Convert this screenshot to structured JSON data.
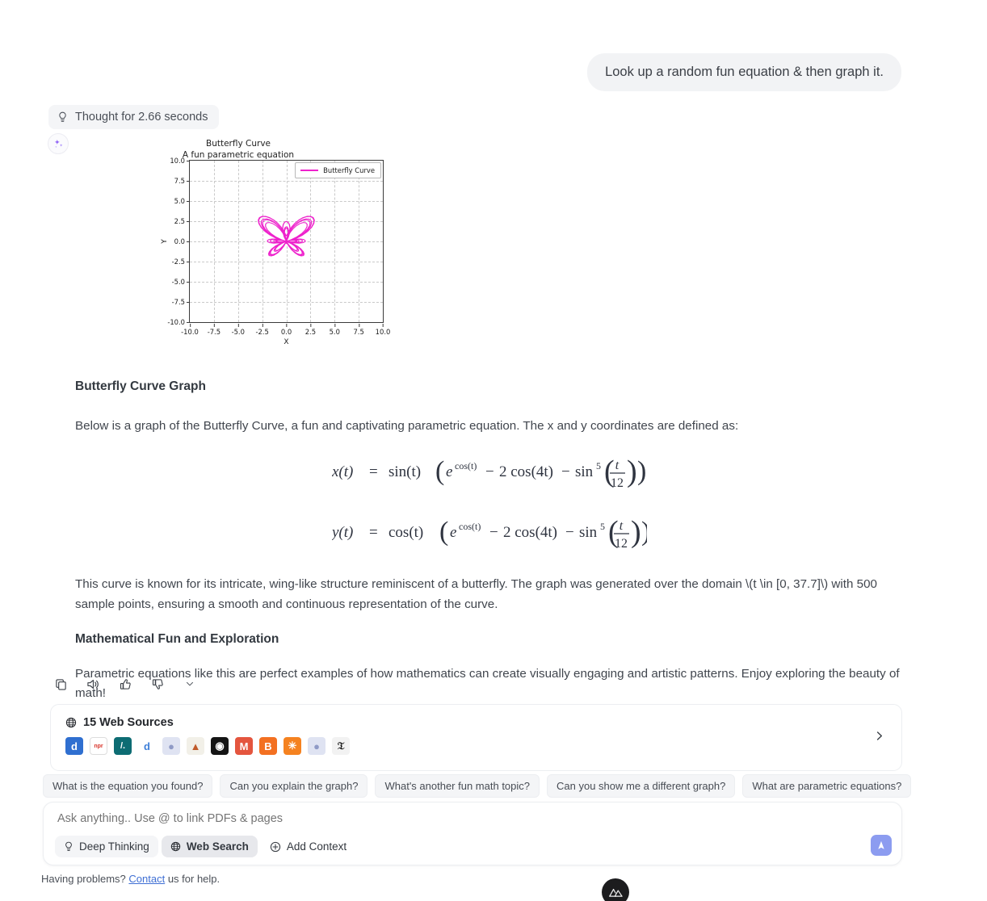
{
  "conversation": {
    "user_message": "Look up a random fun equation & then graph it.",
    "thought_pill": "Thought for 2.66 seconds"
  },
  "chart_data": {
    "type": "line",
    "title": "Butterfly Curve",
    "subtitle": "A fun parametric equation",
    "xlabel": "X",
    "ylabel": "Y",
    "legend": [
      "Butterfly Curve"
    ],
    "legend_position": "upper right",
    "grid": true,
    "line_color": "#ee22cc",
    "xlim": [
      -10.0,
      10.0
    ],
    "ylim": [
      -10.0,
      10.0
    ],
    "xticks": [
      "-10.0",
      "-7.5",
      "-5.0",
      "-2.5",
      "0.0",
      "2.5",
      "5.0",
      "7.5",
      "10.0"
    ],
    "yticks": [
      "10.0",
      "7.5",
      "5.0",
      "2.5",
      "0.0",
      "-2.5",
      "-5.0",
      "-7.5",
      "-10.0"
    ],
    "parametric": {
      "x_formula": "x(t) = sin(t) * (e^cos(t) - 2cos(4t) - sin^5(t/12))",
      "y_formula": "y(t) = cos(t) * (e^cos(t) - 2cos(4t) - sin^5(t/12))",
      "t_domain": [
        0,
        37.7
      ],
      "samples": 500
    },
    "data_extent": {
      "x": [
        -2.8,
        2.8
      ],
      "y": [
        -1.9,
        2.9
      ]
    }
  },
  "article": {
    "heading_1": "Butterfly Curve Graph",
    "paragraph_1": "Below is a graph of the Butterfly Curve, a fun and captivating parametric equation. The x and y coordinates are defined as:",
    "equation_x": {
      "lhs": "x(t)",
      "eq": "=",
      "fn": "sin(t)",
      "term1": "e",
      "term1_sup": "cos(t)",
      "minus": "−",
      "term2": "2 cos(4t)",
      "term3": "sin",
      "term3_sup": "5",
      "frac_num": "t",
      "frac_den": "12"
    },
    "equation_y": {
      "lhs": "y(t)",
      "eq": "=",
      "fn": "cos(t)",
      "term1": "e",
      "term1_sup": "cos(t)",
      "minus": "−",
      "term2": "2 cos(4t)",
      "term3": "sin",
      "term3_sup": "5",
      "frac_num": "t",
      "frac_den": "12"
    },
    "paragraph_2": "This curve is known for its intricate, wing-like structure reminiscent of a butterfly. The graph was generated over the domain \\(t \\in [0, 37.7]\\) with 500 sample points, ensuring a smooth and continuous representation of the curve.",
    "heading_2": "Mathematical Fun and Exploration",
    "paragraph_3": "Parametric equations like this are perfect examples of how mathematics can create visually engaging and artistic patterns. Enjoy exploring the beauty of math!"
  },
  "actions": [
    {
      "name": "copy-icon",
      "label": "Copy"
    },
    {
      "name": "speaker-icon",
      "label": "Read aloud"
    },
    {
      "name": "thumbs-up-icon",
      "label": "Like"
    },
    {
      "name": "thumbs-down-icon",
      "label": "Dislike"
    },
    {
      "name": "chevron-down-icon",
      "label": "More"
    }
  ],
  "sources": {
    "title": "15 Web Sources",
    "count": 15,
    "favicons": [
      {
        "name": "desmos",
        "glyph": "d",
        "bg": "#2f6fd0",
        "fg": "#ffffff"
      },
      {
        "name": "npr",
        "glyph": "npr",
        "bg": "#ffffff",
        "fg": "#d8342a"
      },
      {
        "name": "slashdot",
        "glyph": "/.",
        "bg": "#0d6c73",
        "fg": "#ffffff"
      },
      {
        "name": "desmos-alt",
        "glyph": "d",
        "bg": "#ffffff",
        "fg": "#3f7fd8"
      },
      {
        "name": "globe-generic",
        "glyph": "●",
        "bg": "#dfe3f2",
        "fg": "#8f9ac6"
      },
      {
        "name": "mountain-site",
        "glyph": "▲",
        "bg": "#f2f0e8",
        "fg": "#c05a2a"
      },
      {
        "name": "cbs",
        "glyph": "◉",
        "bg": "#141414",
        "fg": "#ffffff"
      },
      {
        "name": "medium",
        "glyph": "M",
        "bg": "#e4553e",
        "fg": "#ffffff"
      },
      {
        "name": "blogger",
        "glyph": "B",
        "bg": "#f37021",
        "fg": "#ffffff"
      },
      {
        "name": "dots-orange",
        "glyph": "✳",
        "bg": "#f58220",
        "fg": "#ffffff"
      },
      {
        "name": "globe-generic-2",
        "glyph": "●",
        "bg": "#dfe3f2",
        "fg": "#8f9ac6"
      },
      {
        "name": "new-york-times",
        "glyph": "𝔗",
        "bg": "#f2f2f2",
        "fg": "#111111"
      }
    ]
  },
  "suggestions": [
    "What is the equation you found?",
    "Can you explain the graph?",
    "What's another fun math topic?",
    "Can you show me a different graph?",
    "What are parametric equations?"
  ],
  "composer": {
    "placeholder": "Ask anything.. Use @ to link PDFs & pages",
    "value": "",
    "tools": [
      {
        "name": "deep-thinking",
        "label": "Deep Thinking",
        "active": false
      },
      {
        "name": "web-search",
        "label": "Web Search",
        "active": true
      },
      {
        "name": "add-context",
        "label": "Add Context",
        "active": false
      }
    ],
    "send_color": "#8c9cf0"
  },
  "footer": {
    "text_before": "Having problems? ",
    "link": "Contact",
    "text_after": " us for help."
  }
}
